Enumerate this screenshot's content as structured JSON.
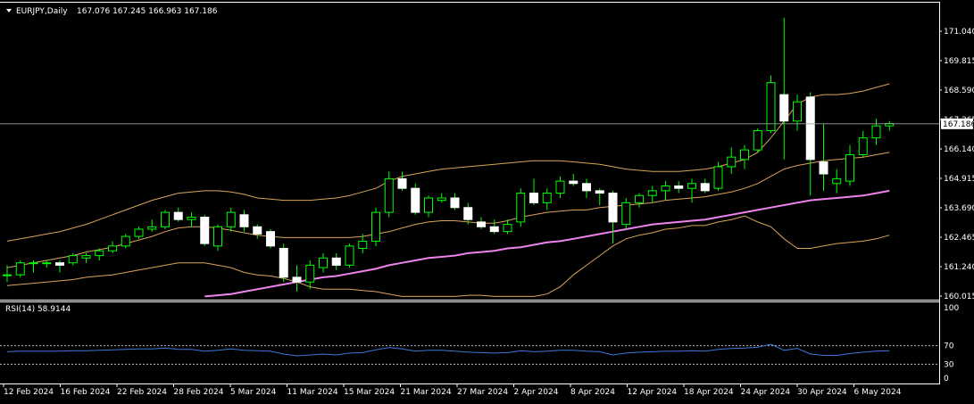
{
  "header": {
    "symbol_label": "EURJPY,Daily",
    "ohlc_label": "167.076 167.245 166.963 167.186"
  },
  "rsi_panel": {
    "label": "RSI(14) 58.9144"
  },
  "chart_data": [
    {
      "type": "candlestick",
      "symbol": "EURJPY",
      "timeframe": "Daily",
      "ylim": [
        160.015,
        171.04
      ],
      "y_ticks": [
        "171.040",
        "169.815",
        "168.590",
        "167.365",
        "166.140",
        "164.915",
        "163.690",
        "162.465",
        "161.240",
        "160.015"
      ],
      "current_price": "167.186",
      "x_ticks": [
        "12 Feb 2024",
        "16 Feb 2024",
        "22 Feb 2024",
        "28 Feb 2024",
        "5 Mar 2024",
        "11 Mar 2024",
        "15 Mar 2024",
        "21 Mar 2024",
        "27 Mar 2024",
        "2 Apr 2024",
        "8 Apr 2024",
        "12 Apr 2024",
        "18 Apr 2024",
        "24 Apr 2024",
        "30 Apr 2024",
        "6 May 2024"
      ],
      "candles": [
        [
          160.9,
          161.3,
          160.6,
          160.9
        ],
        [
          160.9,
          161.5,
          160.8,
          161.4
        ],
        [
          161.4,
          161.5,
          161.0,
          161.4
        ],
        [
          161.4,
          161.5,
          161.2,
          161.4
        ],
        [
          161.4,
          161.5,
          161.0,
          161.3
        ],
        [
          161.4,
          161.8,
          161.3,
          161.7
        ],
        [
          161.6,
          161.8,
          161.4,
          161.7
        ],
        [
          161.7,
          162.0,
          161.5,
          161.9
        ],
        [
          161.9,
          162.3,
          161.8,
          162.1
        ],
        [
          162.1,
          162.6,
          162.0,
          162.5
        ],
        [
          162.5,
          162.9,
          162.4,
          162.8
        ],
        [
          162.8,
          163.2,
          162.7,
          162.9
        ],
        [
          162.9,
          163.6,
          162.8,
          163.5
        ],
        [
          163.5,
          163.7,
          163.1,
          163.2
        ],
        [
          163.2,
          163.5,
          162.9,
          163.3
        ],
        [
          163.3,
          163.4,
          162.1,
          162.2
        ],
        [
          162.1,
          163.0,
          161.9,
          162.9
        ],
        [
          162.9,
          163.7,
          162.7,
          163.5
        ],
        [
          163.4,
          163.6,
          162.7,
          162.9
        ],
        [
          162.9,
          163.0,
          162.4,
          162.6
        ],
        [
          162.7,
          162.8,
          162.0,
          162.1
        ],
        [
          162.0,
          162.2,
          160.6,
          160.8
        ],
        [
          160.8,
          161.3,
          160.2,
          160.6
        ],
        [
          160.6,
          161.5,
          160.3,
          161.3
        ],
        [
          161.2,
          161.8,
          161.0,
          161.6
        ],
        [
          161.6,
          161.8,
          161.1,
          161.3
        ],
        [
          161.3,
          162.2,
          161.2,
          162.1
        ],
        [
          162.0,
          162.6,
          161.8,
          162.3
        ],
        [
          162.3,
          163.7,
          162.1,
          163.5
        ],
        [
          163.5,
          165.2,
          163.3,
          164.9
        ],
        [
          164.9,
          165.2,
          164.4,
          164.5
        ],
        [
          164.5,
          164.7,
          163.4,
          163.5
        ],
        [
          163.5,
          164.2,
          163.3,
          164.1
        ],
        [
          164.0,
          164.3,
          163.9,
          164.1
        ],
        [
          164.1,
          164.3,
          163.6,
          163.7
        ],
        [
          163.7,
          163.9,
          163.0,
          163.2
        ],
        [
          163.1,
          163.3,
          162.8,
          162.9
        ],
        [
          162.9,
          163.2,
          162.6,
          162.7
        ],
        [
          162.7,
          163.2,
          162.6,
          163.0
        ],
        [
          163.1,
          164.5,
          162.9,
          164.3
        ],
        [
          164.3,
          164.9,
          163.8,
          163.9
        ],
        [
          163.9,
          164.5,
          163.6,
          164.3
        ],
        [
          164.3,
          165.0,
          164.1,
          164.8
        ],
        [
          164.8,
          165.1,
          164.6,
          164.7
        ],
        [
          164.7,
          164.9,
          164.1,
          164.4
        ],
        [
          164.4,
          164.5,
          163.8,
          164.3
        ],
        [
          164.3,
          164.4,
          162.2,
          163.1
        ],
        [
          163.0,
          164.1,
          162.8,
          163.9
        ],
        [
          163.9,
          164.3,
          163.7,
          164.2
        ],
        [
          164.2,
          164.6,
          163.9,
          164.4
        ],
        [
          164.4,
          164.8,
          164.0,
          164.6
        ],
        [
          164.6,
          164.8,
          164.3,
          164.5
        ],
        [
          164.5,
          164.9,
          163.9,
          164.7
        ],
        [
          164.7,
          164.9,
          164.3,
          164.4
        ],
        [
          164.5,
          165.6,
          164.4,
          165.4
        ],
        [
          165.4,
          166.2,
          165.1,
          165.8
        ],
        [
          165.7,
          166.3,
          165.3,
          166.1
        ],
        [
          166.1,
          167.0,
          166.0,
          166.9
        ],
        [
          166.9,
          169.2,
          166.8,
          168.9
        ],
        [
          168.4,
          171.6,
          165.7,
          167.3
        ],
        [
          167.3,
          168.4,
          166.9,
          168.1
        ],
        [
          168.3,
          168.5,
          164.2,
          165.7
        ],
        [
          165.6,
          167.2,
          164.4,
          165.1
        ],
        [
          164.7,
          165.3,
          164.3,
          164.9
        ],
        [
          164.8,
          166.3,
          164.6,
          165.9
        ],
        [
          165.9,
          166.9,
          165.8,
          166.6
        ],
        [
          166.6,
          167.4,
          166.3,
          167.1
        ],
        [
          167.1,
          167.3,
          166.9,
          167.2
        ]
      ],
      "bands_upper": [
        162.3,
        162.4,
        162.5,
        162.6,
        162.7,
        162.85,
        163.0,
        163.2,
        163.4,
        163.6,
        163.8,
        164.0,
        164.15,
        164.3,
        164.35,
        164.4,
        164.4,
        164.35,
        164.25,
        164.1,
        164.05,
        164.0,
        164.0,
        164.0,
        164.05,
        164.1,
        164.2,
        164.35,
        164.5,
        164.8,
        165.0,
        165.1,
        165.2,
        165.3,
        165.35,
        165.4,
        165.45,
        165.5,
        165.55,
        165.6,
        165.65,
        165.65,
        165.65,
        165.6,
        165.55,
        165.5,
        165.4,
        165.3,
        165.25,
        165.2,
        165.2,
        165.2,
        165.25,
        165.3,
        165.4,
        165.55,
        165.7,
        166.0,
        166.6,
        167.3,
        168.0,
        168.3,
        168.4,
        168.4,
        168.45,
        168.55,
        168.7,
        168.85
      ],
      "bands_middle": [
        161.2,
        161.3,
        161.4,
        161.5,
        161.6,
        161.7,
        161.85,
        161.95,
        162.05,
        162.2,
        162.35,
        162.5,
        162.7,
        162.85,
        162.9,
        162.9,
        162.85,
        162.75,
        162.65,
        162.55,
        162.5,
        162.45,
        162.45,
        162.45,
        162.45,
        162.45,
        162.45,
        162.5,
        162.6,
        162.7,
        162.85,
        163.0,
        163.1,
        163.15,
        163.15,
        163.1,
        163.05,
        163.05,
        163.15,
        163.3,
        163.4,
        163.5,
        163.55,
        163.6,
        163.6,
        163.7,
        163.75,
        163.8,
        163.85,
        163.9,
        164.0,
        164.05,
        164.1,
        164.15,
        164.25,
        164.35,
        164.5,
        164.7,
        165.0,
        165.3,
        165.45,
        165.55,
        165.65,
        165.7,
        165.75,
        165.8,
        165.9,
        166.0
      ],
      "bands_lower": [
        160.45,
        160.5,
        160.55,
        160.6,
        160.65,
        160.7,
        160.8,
        160.85,
        160.9,
        161.0,
        161.1,
        161.2,
        161.3,
        161.4,
        161.4,
        161.4,
        161.3,
        161.2,
        161.0,
        160.9,
        160.85,
        160.75,
        160.6,
        160.4,
        160.3,
        160.3,
        160.3,
        160.25,
        160.2,
        160.1,
        160.0,
        160.0,
        160.0,
        160.0,
        160.0,
        160.05,
        160.05,
        160.0,
        160.0,
        160.0,
        160.0,
        160.1,
        160.4,
        160.9,
        161.3,
        161.7,
        162.1,
        162.4,
        162.55,
        162.65,
        162.8,
        162.85,
        162.95,
        162.95,
        163.1,
        163.2,
        163.35,
        163.1,
        162.9,
        162.4,
        162.0,
        162.0,
        162.1,
        162.2,
        162.25,
        162.3,
        162.4,
        162.55
      ],
      "moving_average": [
        null,
        null,
        null,
        null,
        null,
        null,
        null,
        null,
        null,
        null,
        null,
        null,
        null,
        null,
        null,
        160.0,
        160.05,
        160.1,
        160.2,
        160.3,
        160.4,
        160.5,
        160.6,
        160.7,
        160.8,
        160.85,
        160.95,
        161.05,
        161.15,
        161.3,
        161.4,
        161.5,
        161.6,
        161.65,
        161.7,
        161.8,
        161.85,
        161.9,
        162.0,
        162.05,
        162.15,
        162.25,
        162.3,
        162.4,
        162.5,
        162.6,
        162.7,
        162.8,
        162.9,
        163.0,
        163.05,
        163.1,
        163.15,
        163.2,
        163.3,
        163.4,
        163.5,
        163.6,
        163.7,
        163.8,
        163.9,
        164.0,
        164.05,
        164.1,
        164.15,
        164.2,
        164.3,
        164.4
      ]
    },
    {
      "type": "line",
      "indicator": "RSI(14)",
      "ylim": [
        0,
        100
      ],
      "y_ticks": [
        "100",
        "70",
        "30",
        "0"
      ],
      "levels": [
        70,
        30
      ],
      "values": [
        57,
        58,
        58,
        58,
        58,
        59,
        59,
        60,
        61,
        62,
        63,
        63,
        65,
        62,
        62,
        58,
        60,
        63,
        60,
        59,
        58,
        52,
        48,
        50,
        52,
        50,
        54,
        55,
        61,
        66,
        63,
        58,
        60,
        60,
        58,
        56,
        55,
        54,
        55,
        59,
        57,
        58,
        60,
        60,
        58,
        57,
        50,
        54,
        56,
        57,
        58,
        58,
        59,
        58,
        62,
        64,
        65,
        67,
        73,
        60,
        64,
        52,
        49,
        49,
        53,
        56,
        58,
        59
      ]
    }
  ]
}
